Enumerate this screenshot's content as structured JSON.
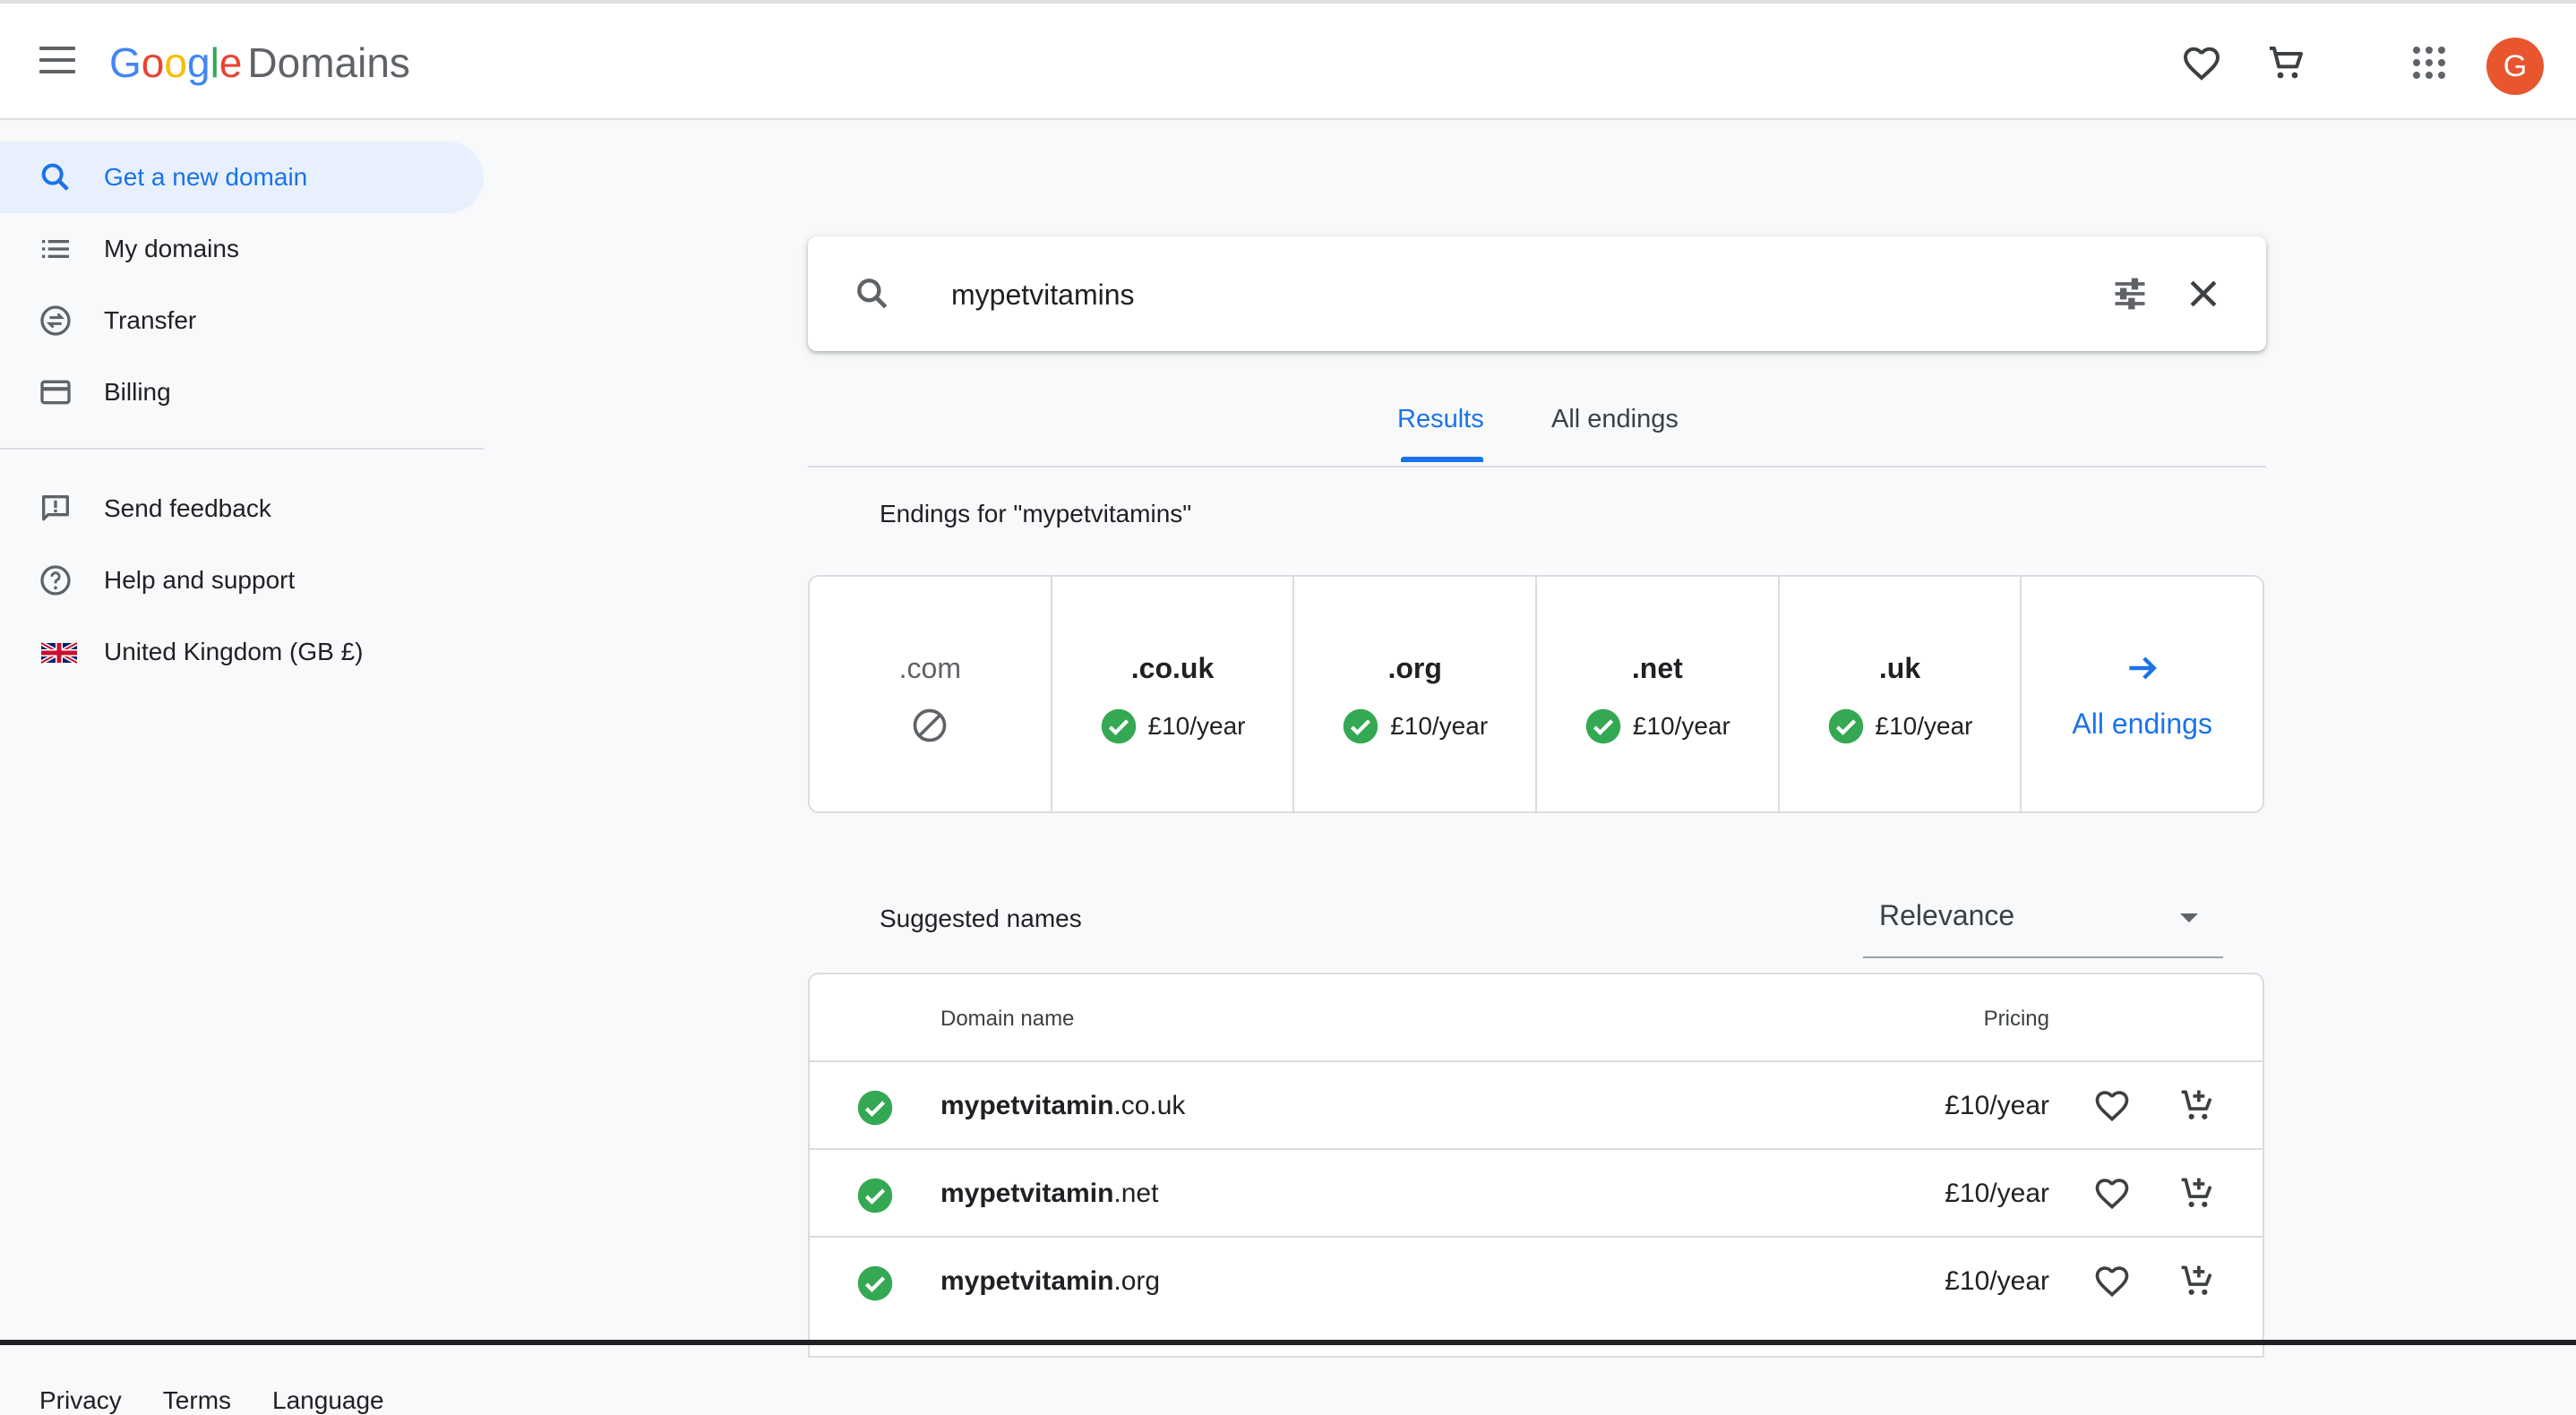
{
  "header": {
    "logo": [
      "G",
      "o",
      "o",
      "g",
      "l",
      "e"
    ],
    "product": "Domains",
    "avatar_letter": "G",
    "icons": [
      "menu-icon",
      "favorite-icon",
      "cart-icon",
      "apps-icon"
    ]
  },
  "sidebar": {
    "items": [
      {
        "label": "Get a new domain",
        "icon": "search-icon",
        "active": true
      },
      {
        "label": "My domains",
        "icon": "list-icon"
      },
      {
        "label": "Transfer",
        "icon": "transfer-icon"
      },
      {
        "label": "Billing",
        "icon": "credit-card-icon"
      }
    ],
    "secondary": [
      {
        "label": "Send feedback",
        "icon": "feedback-icon"
      },
      {
        "label": "Help and support",
        "icon": "help-icon"
      },
      {
        "label": "United Kingdom (GB £)",
        "icon": "uk-flag-icon"
      }
    ],
    "footer": {
      "privacy": "Privacy",
      "terms": "Terms",
      "language": "Language"
    }
  },
  "search": {
    "value": "mypetvitamins",
    "placeholder": ""
  },
  "tabs": [
    {
      "label": "Results",
      "active": true
    },
    {
      "label": "All endings"
    }
  ],
  "endings": {
    "title": "Endings for \"mypetvitamins\"",
    "items": [
      {
        "tld": ".com",
        "available": false
      },
      {
        "tld": ".co.uk",
        "available": true,
        "price": "£10/year"
      },
      {
        "tld": ".org",
        "available": true,
        "price": "£10/year"
      },
      {
        "tld": ".net",
        "available": true,
        "price": "£10/year"
      },
      {
        "tld": ".uk",
        "available": true,
        "price": "£10/year"
      }
    ],
    "all_label": "All endings"
  },
  "suggested": {
    "title": "Suggested names",
    "sort": "Relevance",
    "columns": {
      "domain": "Domain name",
      "pricing": "Pricing"
    },
    "rows": [
      {
        "name": "mypetvitamin",
        "tld": ".co.uk",
        "price": "£10/year"
      },
      {
        "name": "mypetvitamin",
        "tld": ".net",
        "price": "£10/year"
      },
      {
        "name": "mypetvitamin",
        "tld": ".org",
        "price": "£10/year"
      }
    ]
  },
  "colors": {
    "accent": "#1a73e8",
    "available": "#34a853",
    "avatar": "#e8562f",
    "active_bg": "#e8f0fe"
  }
}
